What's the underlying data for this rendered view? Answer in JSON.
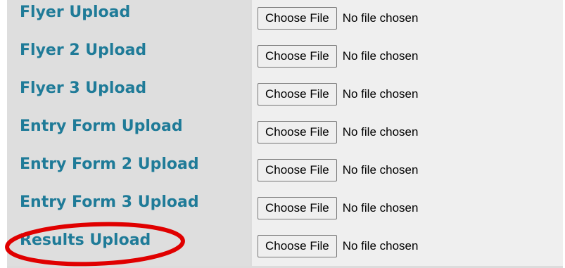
{
  "form": {
    "rows": [
      {
        "label": "Flyer Upload",
        "button": "Choose File",
        "status": "No file chosen"
      },
      {
        "label": "Flyer 2 Upload",
        "button": "Choose File",
        "status": "No file chosen"
      },
      {
        "label": "Flyer 3 Upload",
        "button": "Choose File",
        "status": "No file chosen"
      },
      {
        "label": "Entry Form Upload",
        "button": "Choose File",
        "status": "No file chosen"
      },
      {
        "label": "Entry Form 2 Upload",
        "button": "Choose File",
        "status": "No file chosen"
      },
      {
        "label": "Entry Form 3 Upload",
        "button": "Choose File",
        "status": "No file chosen"
      },
      {
        "label": "Results Upload",
        "button": "Choose File",
        "status": "No file chosen"
      }
    ]
  },
  "annotation": {
    "type": "ellipse",
    "target": "Results Upload",
    "color": "#e00000"
  },
  "colors": {
    "label_text": "#1f7b98",
    "label_background": "#dedede",
    "field_background": "#efefef"
  }
}
